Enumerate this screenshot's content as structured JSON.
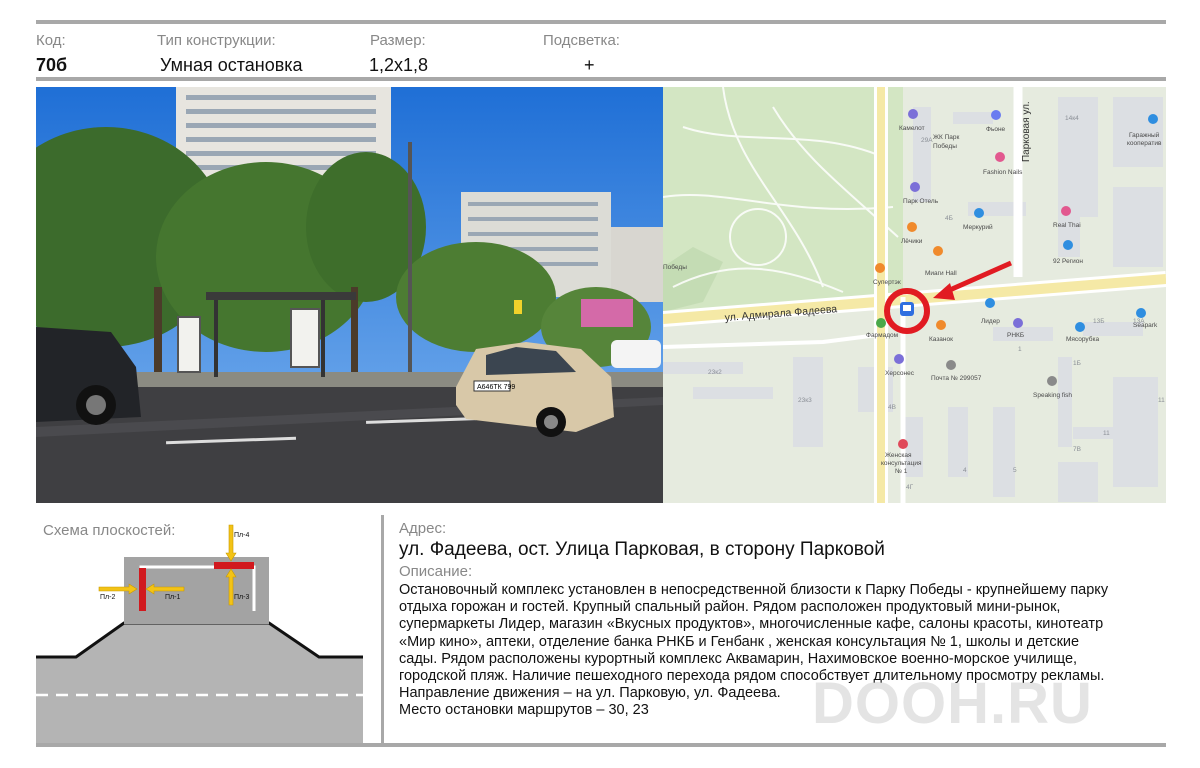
{
  "header": {
    "code_label": "Код:",
    "code_value": "70б",
    "type_label": "Тип конструкции:",
    "type_value": "Умная остановка",
    "size_label": "Размер:",
    "size_value": "1,2x1,8",
    "light_label": "Подсветка:",
    "light_value": "+"
  },
  "photo": {
    "plate_text": "А646ТК 799"
  },
  "map": {
    "street_fadeeva": "ул. Адмирала Фадеева",
    "street_parkovaya": "Парковая ул.",
    "pois": {
      "kamelot": "Камелот",
      "fyone": "Фьоне",
      "jk_park": "ЖК Парк",
      "jk_park2": "Победы",
      "fashion": "Fashion Nails",
      "otel": "Парк Отель",
      "merkurij": "Меркурий",
      "lechik": "Лёчики",
      "miagi": "Миаги Hall",
      "supertek": "Супертэк",
      "lider": "Лидер",
      "rnkb": "РНКБ",
      "farmadom": "Фармадом",
      "kazanok": "Казанок",
      "herson": "Херсонес",
      "pochta": "Почта № 299057",
      "zhenskaya1": "Женская",
      "zhenskaya2": "консультация",
      "zhenskaya3": "№ 1",
      "seapark": "Seapark",
      "mesorubka": "Мясорубка",
      "speaking": "Speaking fish",
      "thai": "Real Thai",
      "region92": "92 Регион",
      "garazh1": "Гаражный",
      "garazh2": "кооператив",
      "obedy": "Победы"
    },
    "houses": {
      "h29a": "29А",
      "h4b_top": "4Б",
      "h14k4": "14к4",
      "h13b": "13Б",
      "h13a": "13А",
      "h23k2": "23к2",
      "h23k3": "23к3",
      "h1": "1",
      "h1b": "1Б",
      "h4v": "4В",
      "h11a": "11",
      "h11b": "11",
      "h7b": "7В",
      "h5": "5",
      "h4g": "4Г",
      "h4": "4"
    }
  },
  "scheme": {
    "title": "Схема плоскостей:",
    "pl1": "Пл-1",
    "pl2": "Пл-2",
    "pl3": "Пл-3",
    "pl4": "Пл-4"
  },
  "address": {
    "label": "Адрес:",
    "value": "ул. Фадеева, ост. Улица Парковая, в сторону Парковой"
  },
  "description": {
    "label": "Описание:",
    "lines": [
      "Остановочный комплекс установлен в непосредственной близости к Парку Победы - крупнейшему парку",
      "отдыха горожан и гостей.  Крупный спальный район. Рядом расположен продуктовый мини-рынок,",
      "супермаркеты Лидер, магазин «Вкусных продуктов», многочисленные  кафе, салоны красоты, кинотеатр",
      "«Мир кино»,  аптеки,    отделение банка РНКБ и Генбанк , женская консультация № 1, школы и детские",
      "сады. Рядом расположены курортный комплекс Аквамарин, Нахимовское военно-морское училище,",
      "городской пляж. Наличие пешеходного перехода рядом способствует  длительному просмотру рекламы.",
      "Направление движения –  на ул. Парковую, ул. Фадеева.",
      "Место остановки маршрутов – 30, 23"
    ]
  },
  "watermark": "DOOH.RU",
  "colors": {
    "accent_red": "#e11b22",
    "label_gray": "#888888",
    "rule_gray": "#a8a8a8",
    "arrow_yellow": "#f3c316"
  }
}
